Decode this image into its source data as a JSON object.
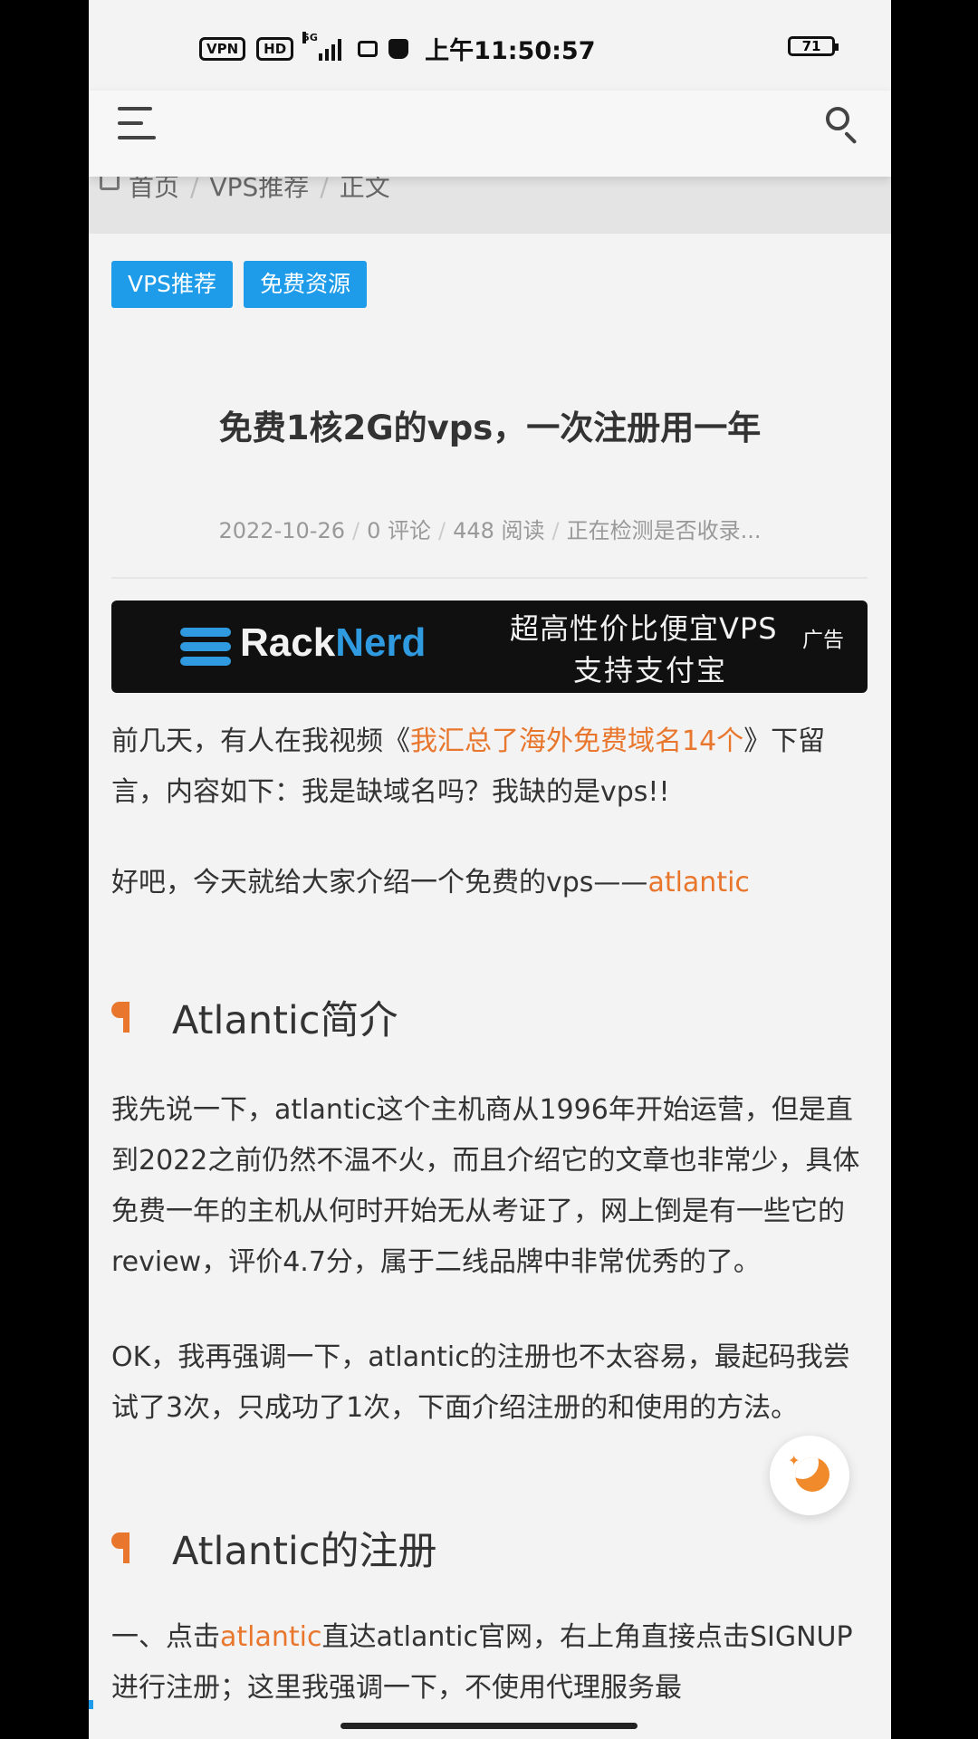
{
  "status_bar": {
    "vpn_badge": "VPN",
    "hd_badge": "HD",
    "network_label": "5G",
    "time": "上午11:50:57",
    "battery": "71"
  },
  "breadcrumb": {
    "home": "首页",
    "category": "VPS推荐",
    "current": "正文",
    "separator": "/"
  },
  "tags": [
    "VPS推荐",
    "免费资源"
  ],
  "post": {
    "title": "免费1核2G的vps，一次注册用一年",
    "meta": {
      "date": "2022-10-26",
      "comments": "0 评论",
      "reads": "448 阅读",
      "index_status": "正在检测是否收录...",
      "separator": "/"
    }
  },
  "ad": {
    "brand_part1": "Rack",
    "brand_part2": "Nerd",
    "line1": "超高性价比便宜VPS",
    "line2": "支持支付宝",
    "badge": "广告",
    "brand_color": "#2f9ae0"
  },
  "body": {
    "p1_before": "前几天，有人在我视频《",
    "p1_link": "我汇总了海外免费域名14个",
    "p1_after": "》下留言，内容如下：我是缺域名吗？我缺的是vps!!",
    "p2_before": "好吧，今天就给大家介绍一个免费的vps——",
    "p2_link": "atlantic",
    "h2_intro": "Atlantic简介",
    "p3": "我先说一下，atlantic这个主机商从1996年开始运营，但是直到2022之前仍然不温不火，而且介绍它的文章也非常少，具体免费一年的主机从何时开始无从考证了，网上倒是有一些它的review，评价4.7分，属于二线品牌中非常优秀的了。",
    "p4": "OK，我再强调一下，atlantic的注册也不太容易，最起码我尝试了3次，只成功了1次，下面介绍注册的和使用的方法。",
    "h2_register": "Atlantic的注册",
    "p5_before": "一、点击",
    "p5_link": "atlantic",
    "p5_after": "直达atlantic官网，右上角直接点击SIGNUP 进行注册；这里我强调一下，不使用代理服务最"
  },
  "colors": {
    "accent_link": "#e8762d",
    "tag_bg": "#1e9be9",
    "page_bg": "#f3f3f3"
  },
  "icons": [
    "menu-icon",
    "search-icon",
    "home-icon",
    "night-mode-icon",
    "racknerd-logo-icon"
  ]
}
